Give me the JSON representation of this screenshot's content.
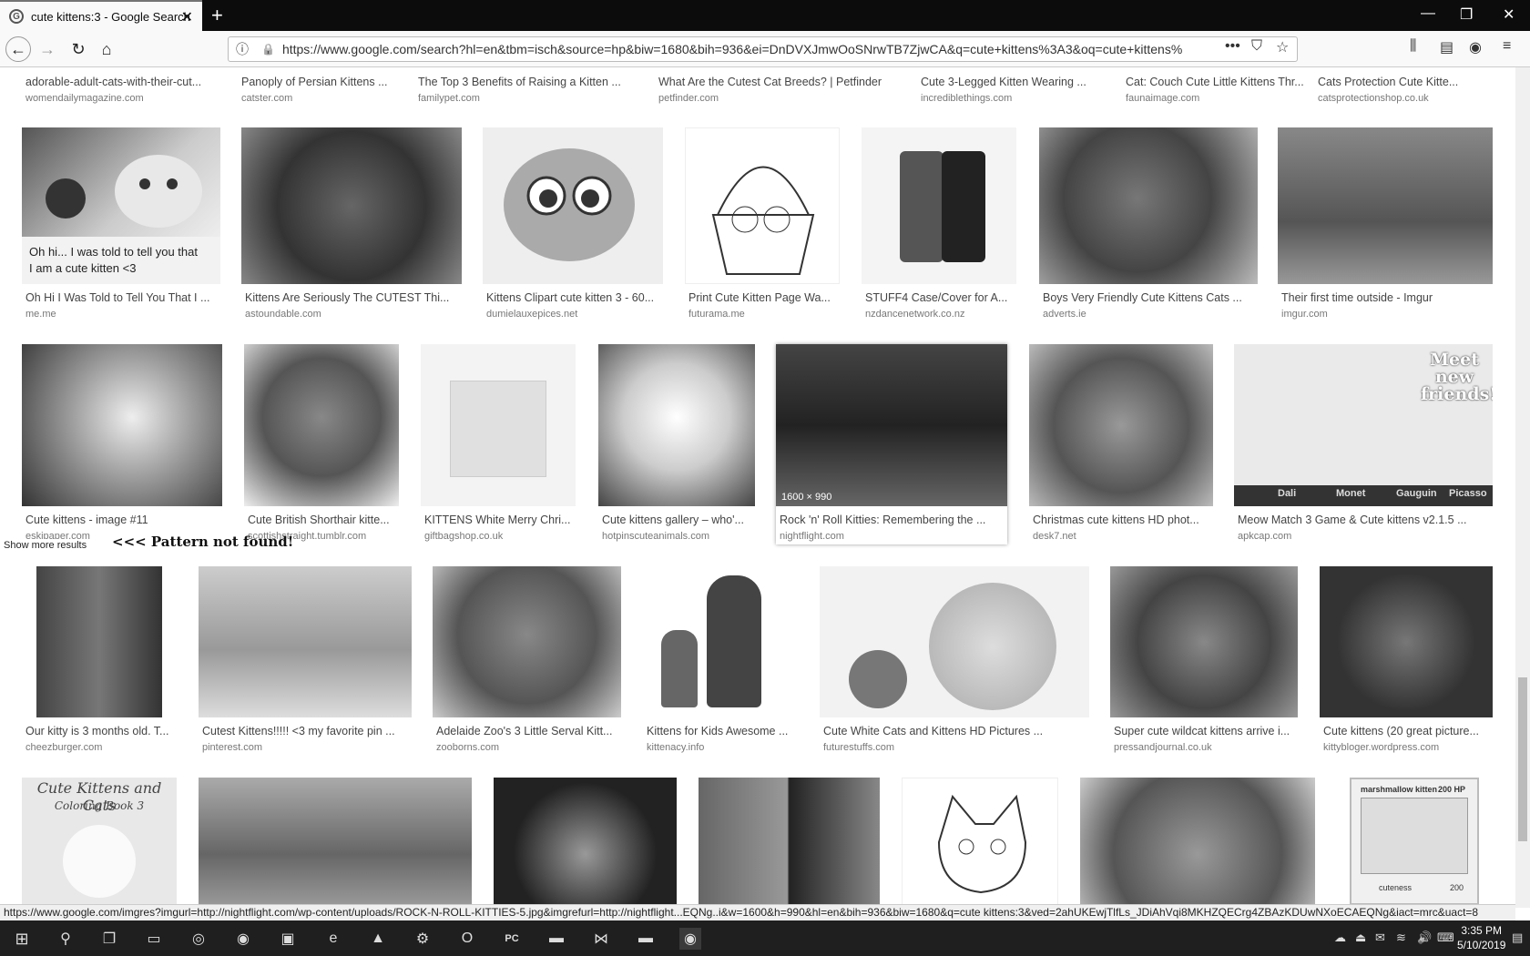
{
  "browser": {
    "tab_title": "cute kittens:3 - Google Search",
    "tab_favicon": "G",
    "url": "https://www.google.com/search?hl=en&tbm=isch&source=hp&biw=1680&bih=936&ei=DnDVXJmwOoSNrwTB7ZjwCA&q=cute+kittens%3A3&oq=cute+kittens%",
    "status_url": "https://www.google.com/imgres?imgurl=http://nightflight.com/wp-content/uploads/ROCK-N-ROLL-KITTIES-5.jpg&imgrefurl=http://nightflight...EQNg..i&w=1600&h=990&hl=en&bih=936&biw=1680&q=cute kittens:3&ved=2ahUKEwjTlfLs_JDiAhVqi8MKHZQECrg4ZBAzKDUwNXoECAEQNg&iact=mrc&uact=8"
  },
  "page": {
    "show_more": "Show more results",
    "pattern_not_found": "<<< Pattern not found!",
    "hover_dimensions": "1600 × 990",
    "overlay_caption_line1": "Oh hi... I was told to tell you that",
    "overlay_caption_line2": "I am a cute kitten <3"
  },
  "results": [
    {
      "title": "adorable-adult-cats-with-their-cut...",
      "source": "womendailymagazine.com"
    },
    {
      "title": "Panoply of Persian Kittens ...",
      "source": "catster.com"
    },
    {
      "title": "The Top 3 Benefits of Raising a Kitten ...",
      "source": "familypet.com"
    },
    {
      "title": "What Are the Cutest Cat Breeds? | Petfinder",
      "source": "petfinder.com"
    },
    {
      "title": "Cute 3-Legged Kitten Wearing ...",
      "source": "incrediblethings.com"
    },
    {
      "title": "Cat: Couch Cute Little Kittens Thr...",
      "source": "faunaimage.com"
    },
    {
      "title": "Cats Protection Cute Kitte...",
      "source": "catsprotectionshop.co.uk"
    },
    {
      "title": "Oh Hi I Was Told to Tell You That I ...",
      "source": "me.me"
    },
    {
      "title": "Kittens Are Seriously The CUTEST Thi...",
      "source": "astoundable.com"
    },
    {
      "title": "Kittens Clipart cute kitten 3 - 60...",
      "source": "dumielauxepices.net"
    },
    {
      "title": "Print Cute Kitten Page Wa...",
      "source": "futurama.me"
    },
    {
      "title": "STUFF4 Case/Cover for A...",
      "source": "nzdancenetwork.co.nz"
    },
    {
      "title": "Boys Very Friendly Cute Kittens Cats ...",
      "source": "adverts.ie"
    },
    {
      "title": "Their first time outside - Imgur",
      "source": "imgur.com"
    },
    {
      "title": "Cute kittens - image #11",
      "source": "eskipaper.com"
    },
    {
      "title": "Cute British Shorthair kitte...",
      "source": "scottishstraight.tumblr.com"
    },
    {
      "title": "KITTENS White Merry Chri...",
      "source": "giftbagshop.co.uk"
    },
    {
      "title": "Cute kittens gallery – who'...",
      "source": "hotpinscuteanimals.com"
    },
    {
      "title": "Rock 'n' Roll Kitties: Remembering the ...",
      "source": "nightflight.com"
    },
    {
      "title": "Christmas cute kittens HD phot...",
      "source": "desk7.net"
    },
    {
      "title": "Meow Match 3 Game & Cute kittens v2.1.5 ...",
      "source": "apkcap.com"
    },
    {
      "title": "Our kitty is 3 months old. T...",
      "source": "cheezburger.com"
    },
    {
      "title": "Cutest Kittens!!!!! <3 my favorite pin ...",
      "source": "pinterest.com"
    },
    {
      "title": "Adelaide Zoo's 3 Little Serval Kitt...",
      "source": "zooborns.com"
    },
    {
      "title": "Kittens for Kids Awesome ...",
      "source": "kittenacy.info"
    },
    {
      "title": "Cute White Cats and Kittens HD Pictures ...",
      "source": "futurestuffs.com"
    },
    {
      "title": "Super cute wildcat kittens arrive i...",
      "source": "pressandjournal.co.uk"
    },
    {
      "title": "Cute kittens (20 great picture...",
      "source": "kittybloger.wordpress.com"
    }
  ],
  "row5_thumb_text": {
    "coloring_book_line1": "Cute Kittens and Cats",
    "coloring_book_line2": "Coloring Book 3",
    "card_name": "marshmallow kitten",
    "card_hp": "200 HP",
    "card_attack": "cuteness",
    "card_damage": "200"
  },
  "meow_thumb_text": {
    "banner": "Meet new friends!",
    "strip": [
      "Dali",
      "Monet",
      "Gauguin",
      "Picasso"
    ]
  },
  "taskbar": {
    "time": "3:35 PM",
    "date": "5/10/2019"
  }
}
